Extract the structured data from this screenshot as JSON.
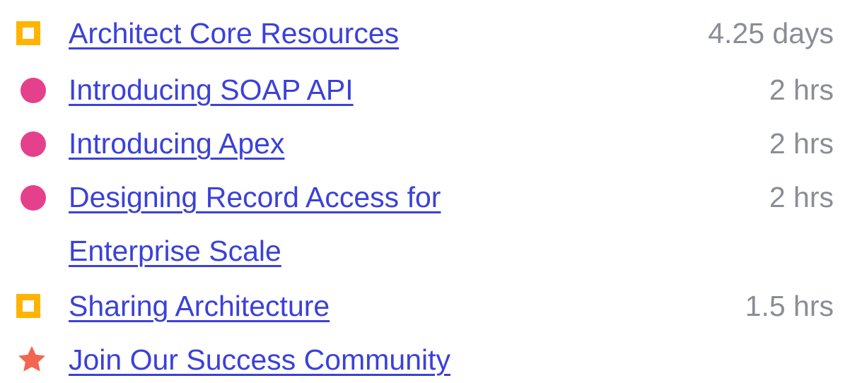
{
  "colors": {
    "link": "#3B41D9",
    "duration_text": "#8A8D96",
    "trailmix_icon": "#FFB400",
    "module_icon": "#E5408B",
    "community_icon": "#F26650"
  },
  "items": [
    {
      "icon": "trailmix-square-icon",
      "title": "Architect Core Resources",
      "duration": "4.25 days"
    },
    {
      "icon": "module-dot-icon",
      "title": "Introducing SOAP API",
      "duration": "2 hrs"
    },
    {
      "icon": "module-dot-icon",
      "title": "Introducing Apex",
      "duration": "2 hrs"
    },
    {
      "icon": "module-dot-icon",
      "title_line1": "Designing Record Access for ",
      "title_line2": "Enterprise Scale",
      "duration": "2 hrs"
    },
    {
      "icon": "trailmix-square-icon",
      "title": "Sharing Architecture",
      "duration": "1.5 hrs"
    },
    {
      "icon": "star-icon",
      "title": "Join Our Success Community"
    }
  ]
}
